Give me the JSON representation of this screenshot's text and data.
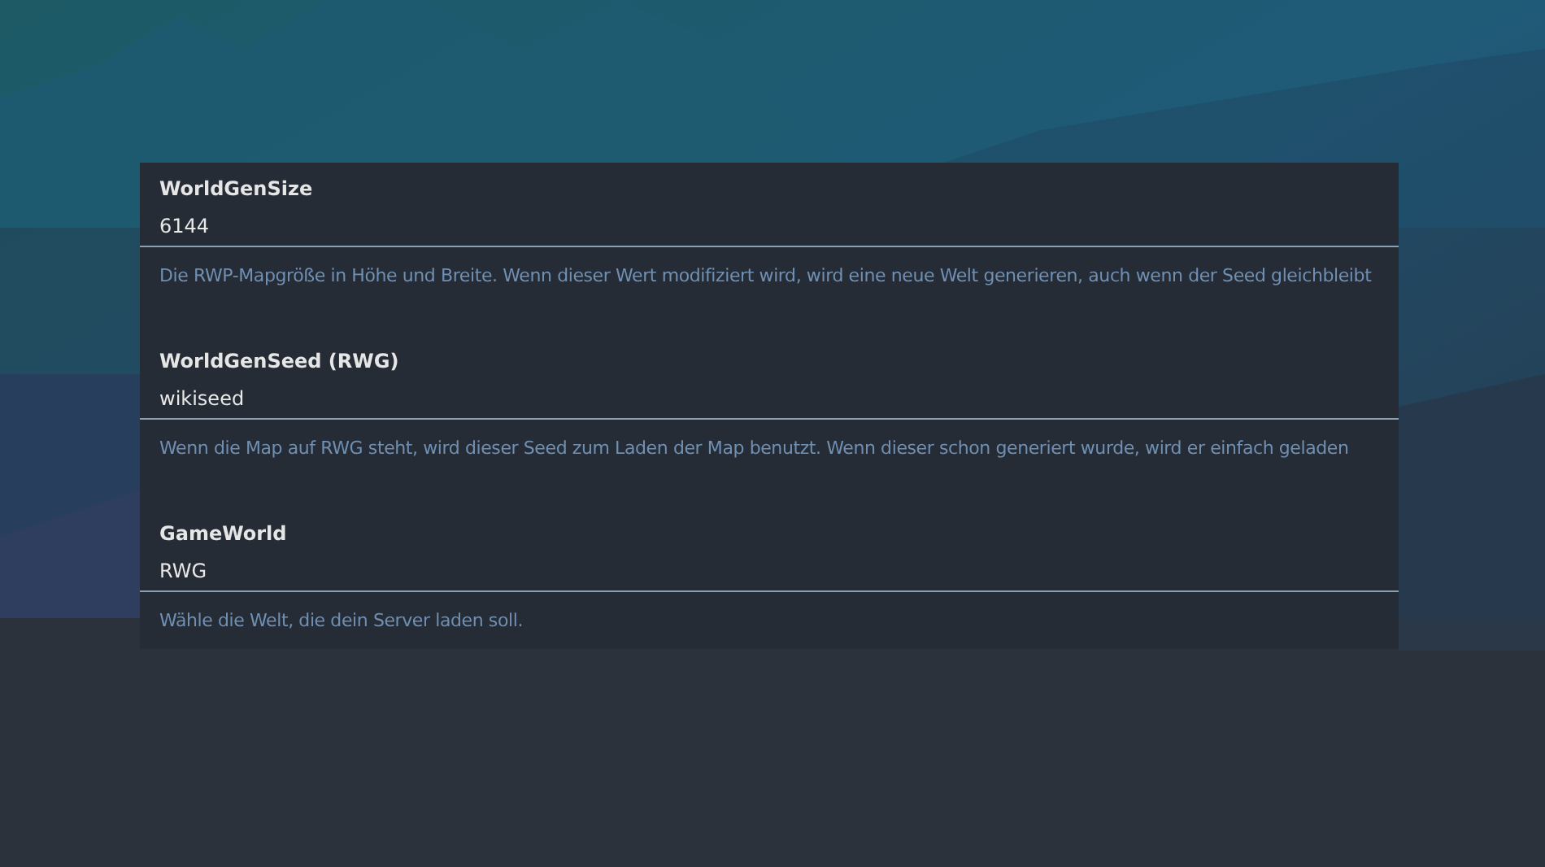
{
  "settings": [
    {
      "label": "WorldGenSize",
      "value": "6144",
      "description": "Die RWP-Mapgröße in Höhe und Breite. Wenn dieser Wert modifiziert wird, wird eine neue Welt generieren, auch wenn der Seed gleichbleibt"
    },
    {
      "label": "WorldGenSeed (RWG)",
      "value": "wikiseed",
      "description": "Wenn die Map auf RWG steht, wird dieser Seed zum Laden der Map benutzt. Wenn dieser schon generiert wurde, wird er einfach geladen"
    },
    {
      "label": "GameWorld",
      "value": "RWG",
      "description": "Wähle die Welt, die dein Server laden soll."
    }
  ]
}
